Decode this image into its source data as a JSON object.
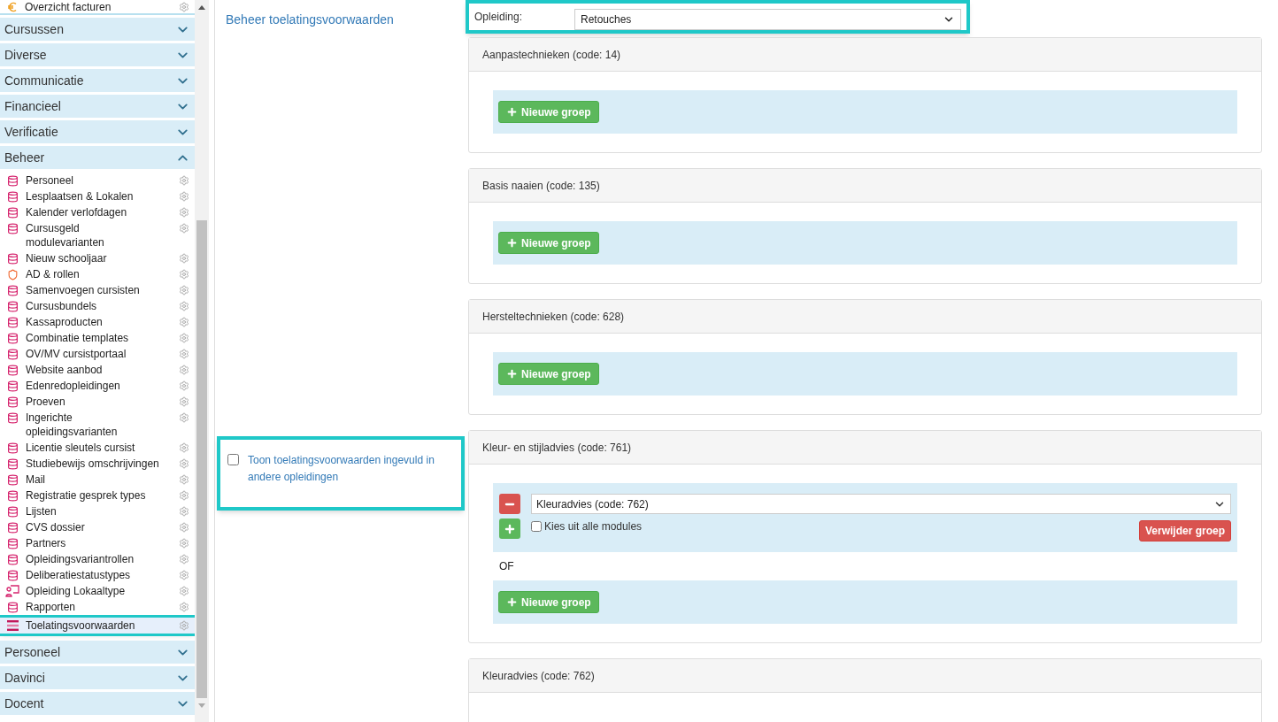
{
  "sidebar": {
    "top_item": {
      "label": "Overzicht facturen"
    },
    "sections": [
      {
        "label": "Cursussen",
        "expanded": false
      },
      {
        "label": "Diverse",
        "expanded": false
      },
      {
        "label": "Communicatie",
        "expanded": false
      },
      {
        "label": "Financieel",
        "expanded": false
      },
      {
        "label": "Verificatie",
        "expanded": false
      },
      {
        "label": "Beheer",
        "expanded": true,
        "items": [
          {
            "label": "Personeel",
            "kind": "database",
            "selected": false
          },
          {
            "label": "Lesplaatsen & Lokalen",
            "kind": "database",
            "selected": false
          },
          {
            "label": "Kalender verlofdagen",
            "kind": "database",
            "selected": false
          },
          {
            "label": "Cursusgeld modulevarianten",
            "kind": "database",
            "selected": false
          },
          {
            "label": "Nieuw schooljaar",
            "kind": "database",
            "selected": false
          },
          {
            "label": "AD & rollen",
            "kind": "shield",
            "selected": false
          },
          {
            "label": "Samenvoegen cursisten",
            "kind": "database",
            "selected": false
          },
          {
            "label": "Cursusbundels",
            "kind": "database",
            "selected": false
          },
          {
            "label": "Kassaproducten",
            "kind": "database",
            "selected": false
          },
          {
            "label": "Combinatie templates",
            "kind": "database",
            "selected": false
          },
          {
            "label": "OV/MV cursistportaal",
            "kind": "database",
            "selected": false
          },
          {
            "label": "Website aanbod",
            "kind": "database",
            "selected": false
          },
          {
            "label": "Edenredopleidingen",
            "kind": "database",
            "selected": false
          },
          {
            "label": "Proeven",
            "kind": "database",
            "selected": false
          },
          {
            "label": "Ingerichte opleidingsvarianten",
            "kind": "database",
            "selected": false
          },
          {
            "label": "Licentie sleutels cursist",
            "kind": "database",
            "selected": false
          },
          {
            "label": "Studiebewijs omschrijvingen",
            "kind": "database",
            "selected": false
          },
          {
            "label": "Mail",
            "kind": "database",
            "selected": false
          },
          {
            "label": "Registratie gesprek types",
            "kind": "database",
            "selected": false
          },
          {
            "label": "Lijsten",
            "kind": "database",
            "selected": false
          },
          {
            "label": "CVS dossier",
            "kind": "database",
            "selected": false
          },
          {
            "label": "Partners",
            "kind": "database",
            "selected": false
          },
          {
            "label": "Opleidingsvariantrollen",
            "kind": "database",
            "selected": false
          },
          {
            "label": "Deliberatiestatustypes",
            "kind": "database",
            "selected": false
          },
          {
            "label": "Opleiding Lokaaltype",
            "kind": "teacher",
            "selected": false
          },
          {
            "label": "Rapporten",
            "kind": "database",
            "selected": false
          },
          {
            "label": "Toelatingsvoorwaarden",
            "kind": "list",
            "selected": true
          }
        ]
      },
      {
        "label": "Personeel",
        "expanded": false
      },
      {
        "label": "Davinci",
        "expanded": false
      },
      {
        "label": "Docent",
        "expanded": false
      }
    ]
  },
  "page": {
    "title": "Beheer toelatingsvoorwaarden",
    "show_other": {
      "label": "Toon toelatingsvoorwaarden ingevuld in andere opleidingen",
      "checked": false
    },
    "opleiding": {
      "label": "Opleiding:",
      "value": "Retouches"
    },
    "panels": [
      {
        "title": "Aanpastechnieken (code: 14)",
        "new_group_button": "Nieuwe groep"
      },
      {
        "title": "Basis naaien (code: 135)",
        "new_group_button": "Nieuwe groep"
      },
      {
        "title": "Hersteltechnieken (code: 628)",
        "new_group_button": "Nieuwe groep"
      },
      {
        "title": "Kleur- en stijladvies (code: 761)",
        "groups": [
          {
            "module": "Kleuradvies (code: 762)",
            "choose_all": {
              "label": "Kies uit alle modules",
              "checked": false
            },
            "delete_button": "Verwijder groep"
          }
        ],
        "separator": "OF",
        "new_group_button": "Nieuwe groep"
      },
      {
        "title": "Kleuradvies (code: 762)"
      }
    ]
  }
}
